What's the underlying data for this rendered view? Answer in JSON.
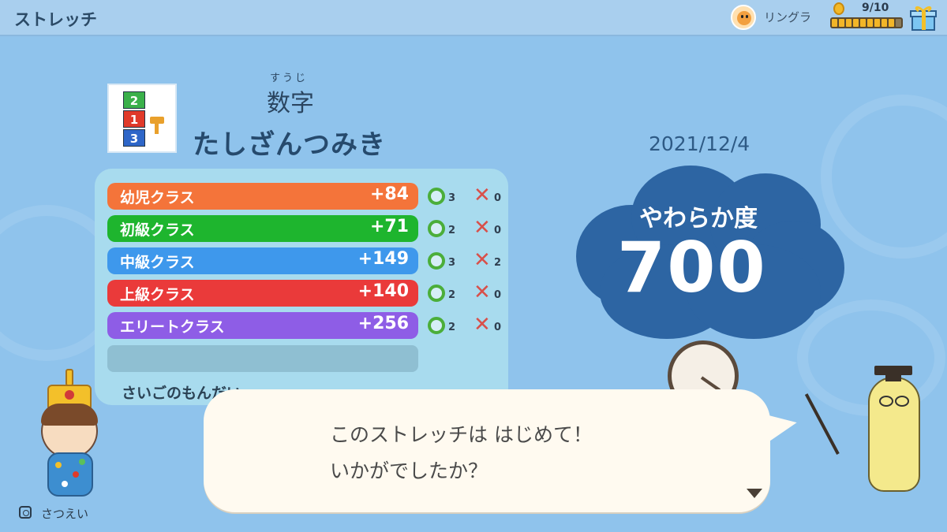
{
  "header": {
    "title": "ストレッチ",
    "user_name": "リングラ",
    "stamina": "9/10",
    "icons": {
      "user": "user-avatar",
      "coin": "coin-icon",
      "gift": "gift-icon"
    }
  },
  "exercise": {
    "category_ruby": "すうじ",
    "category": "数字",
    "name": "たしざんつみき",
    "icon_blocks": [
      "2",
      "1",
      "3"
    ]
  },
  "results": [
    {
      "label": "幼児クラス",
      "score": "+84",
      "correct": "3",
      "wrong": "0",
      "color": "#f4743a"
    },
    {
      "label": "初級クラス",
      "score": "+71",
      "correct": "2",
      "wrong": "0",
      "color": "#1eb52e"
    },
    {
      "label": "中級クラス",
      "score": "+149",
      "correct": "3",
      "wrong": "2",
      "color": "#3e98ec"
    },
    {
      "label": "上級クラス",
      "score": "+140",
      "correct": "2",
      "wrong": "0",
      "color": "#ea3a3a"
    },
    {
      "label": "エリートクラス",
      "score": "+256",
      "correct": "2",
      "wrong": "0",
      "color": "#8e5de6"
    }
  ],
  "last_problem_label": "さいごのもんだい",
  "date": "2021/12/4",
  "flexibility": {
    "label": "やわらか度",
    "value": "700"
  },
  "dialog": {
    "line1": "このストレッチは はじめて！",
    "line2": "いかがでしたか？"
  },
  "capture": {
    "label": "さつえい"
  },
  "colors": {
    "background": "#8fc3ec",
    "cloud": "#2d65a3",
    "panel": "#a8dbee"
  }
}
